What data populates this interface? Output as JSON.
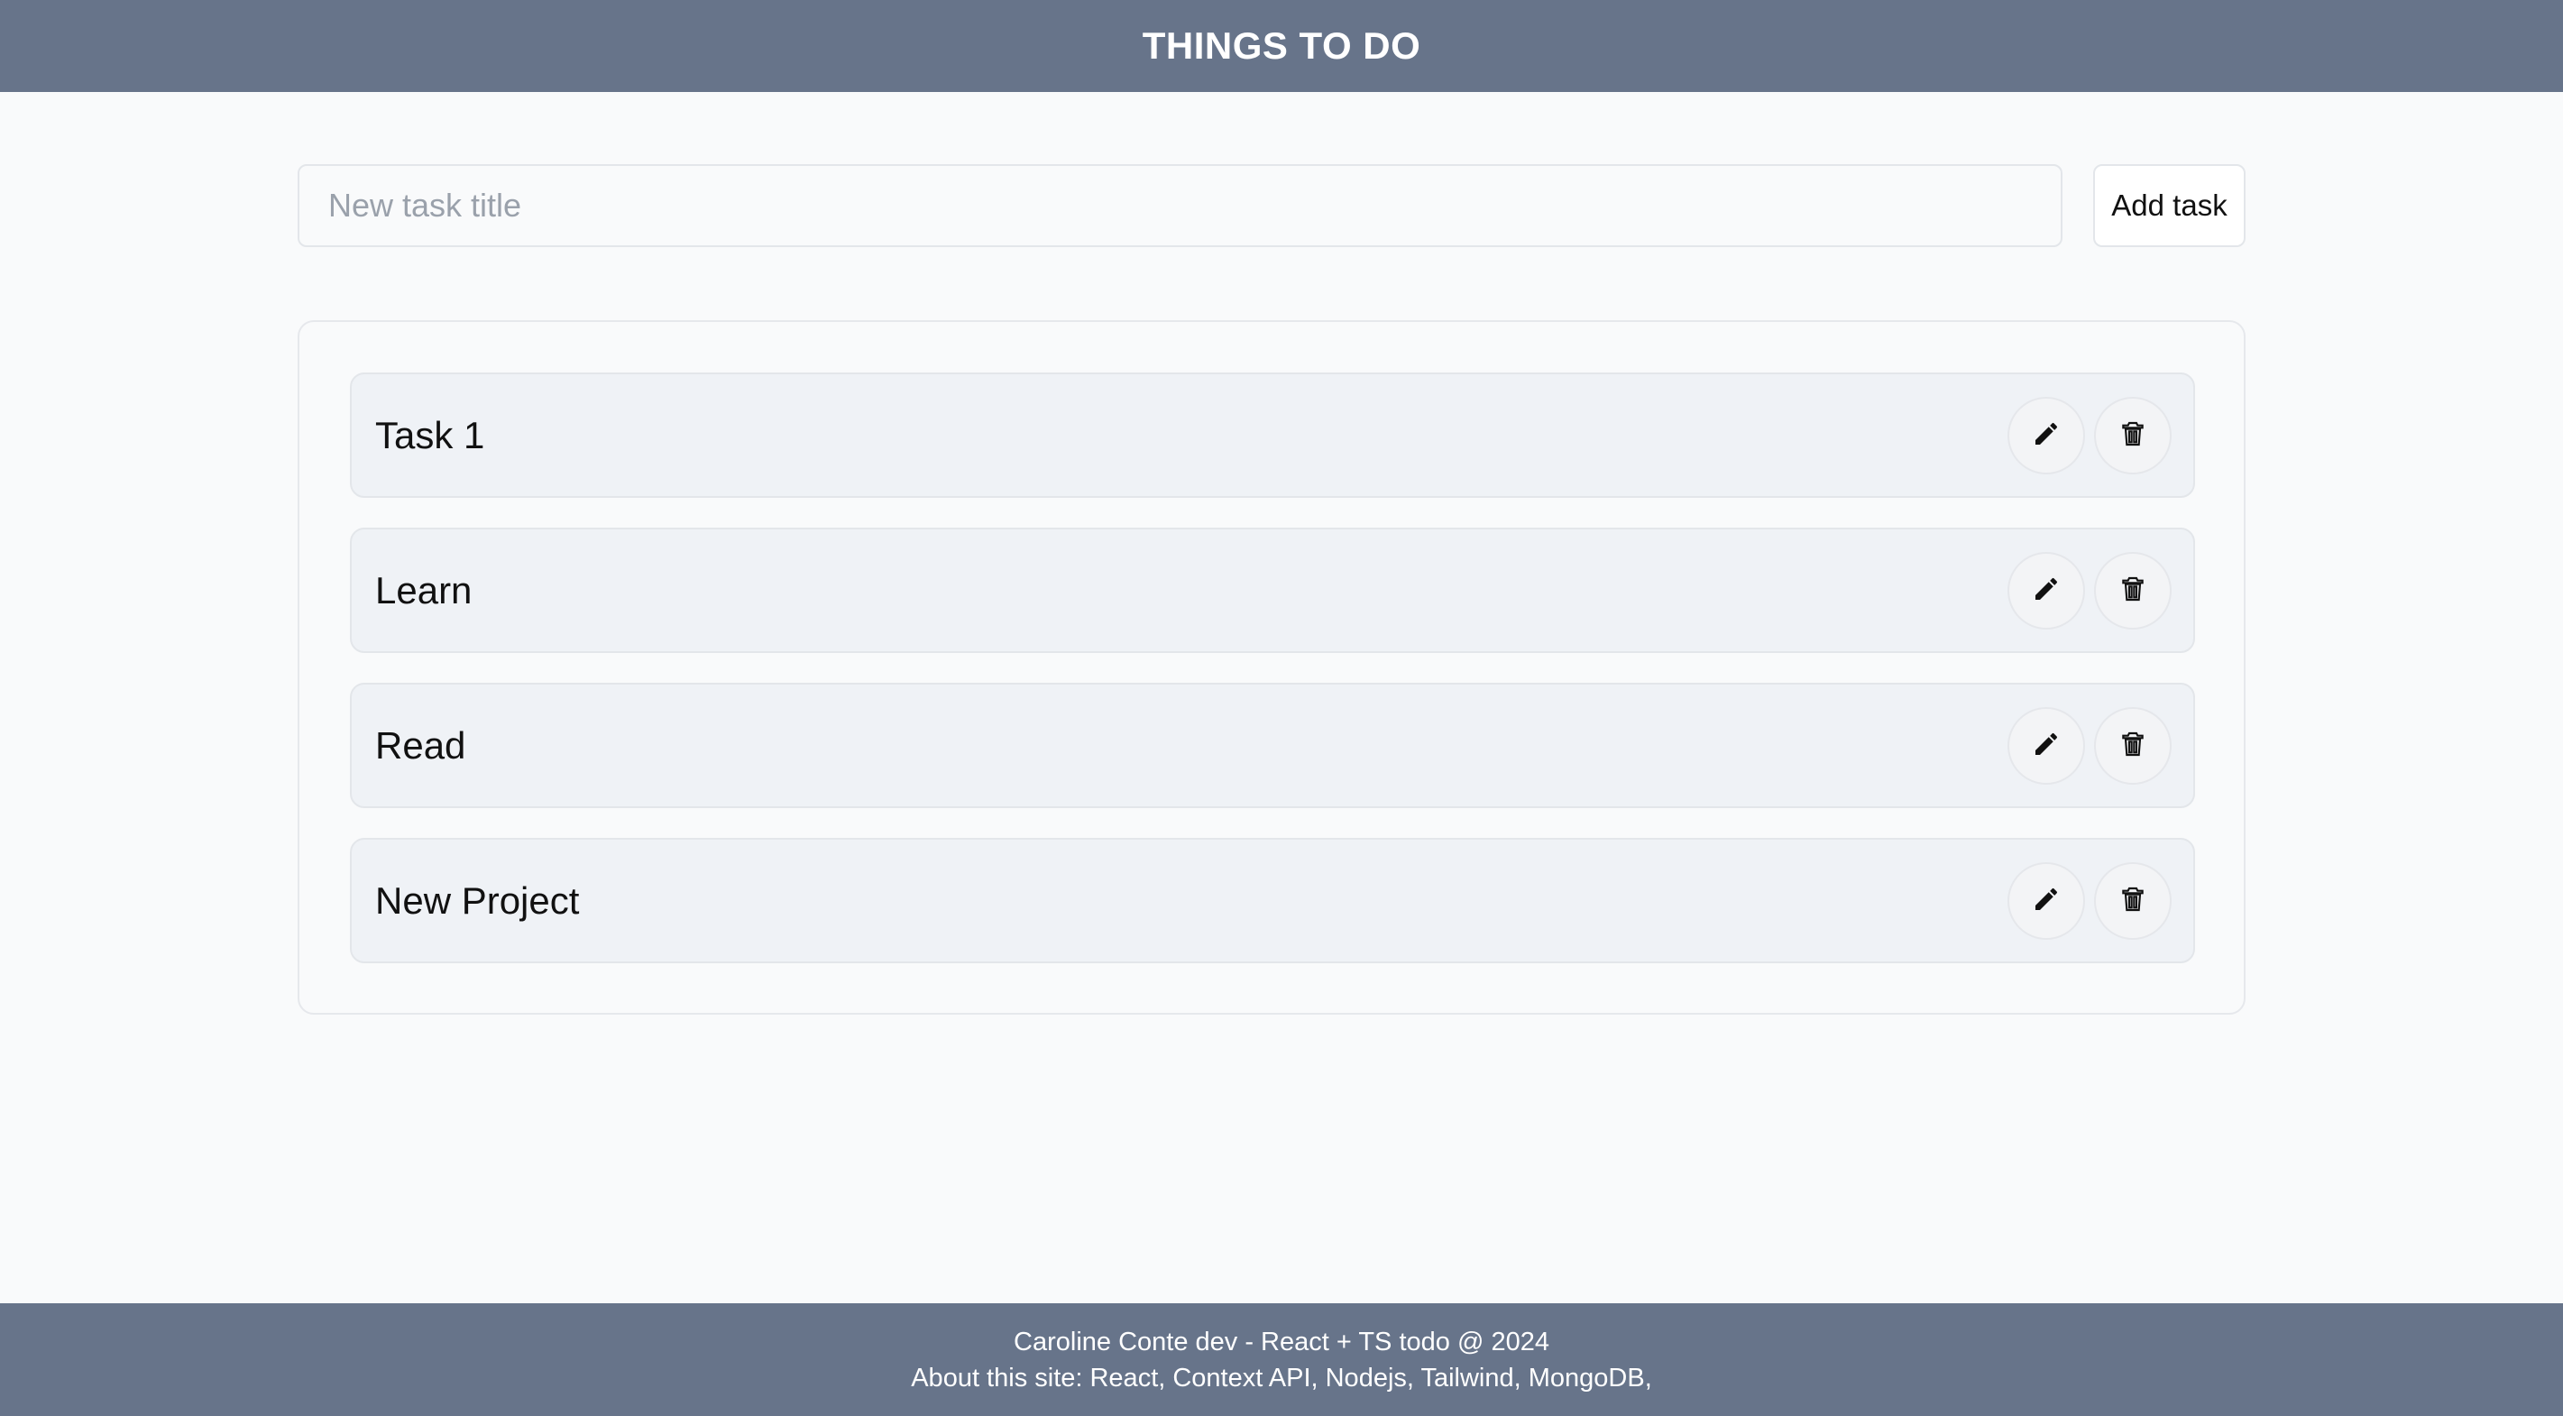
{
  "header": {
    "title": "THINGS TO DO"
  },
  "new_task": {
    "placeholder": "New task title",
    "value": "",
    "add_label": "Add task"
  },
  "tasks": [
    {
      "title": "Task 1"
    },
    {
      "title": "Learn"
    },
    {
      "title": "Read"
    },
    {
      "title": "New Project"
    }
  ],
  "task_actions": {
    "edit_icon": "pencil-icon",
    "delete_icon": "trash-icon"
  },
  "footer": {
    "line1": "Caroline Conte dev - React + TS todo @ 2024",
    "line2": "About this site: React, Context API, Nodejs, Tailwind, MongoDB,"
  },
  "colors": {
    "header_bg": "#67748a",
    "footer_bg": "#67748a",
    "page_bg": "#f9fafb",
    "task_bg": "#eff2f6"
  }
}
